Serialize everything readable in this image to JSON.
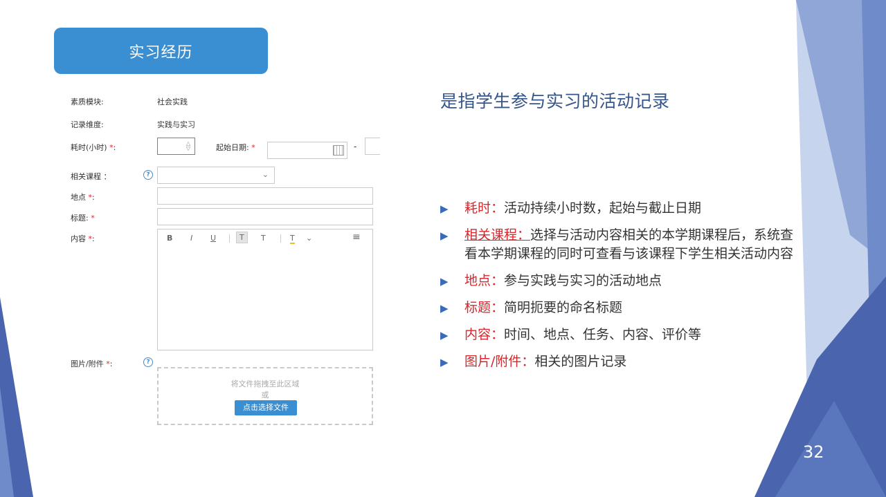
{
  "header": {
    "title": "实习经历"
  },
  "form": {
    "module_label": "素质模块:",
    "module_value": "社会实践",
    "dimension_label": "记录维度:",
    "dimension_value": "实践与实习",
    "hours_label": "耗时(小时)",
    "start_date_label": "起始日期:",
    "date_separator": "-",
    "course_label": "相关课程 ：",
    "location_label": "地点",
    "title_label": "标题:",
    "content_label": "内容",
    "attachment_label": "图片/附件",
    "required_mark": "*",
    "colon": ":",
    "editor_toolbar": {
      "bold": "B",
      "italic": "I",
      "underline": "U",
      "font_size": "T",
      "text_style": "T",
      "font_color": "T"
    },
    "upload": {
      "hint": "将文件拖拽至此区域",
      "or": "或",
      "button": "点击选择文件"
    }
  },
  "heading": "是指学生参与实习的活动记录",
  "bullets": [
    {
      "term": "耗时",
      "sep": "：",
      "text": "活动持续小时数，起始与截止日期"
    },
    {
      "term": "相关课程：",
      "sep": "",
      "text": "选择与活动内容相关的本学期课程后，系统查看本学期课程的同时可查看与该课程下学生相关活动内容"
    },
    {
      "term": "地点",
      "sep": "：",
      "text": "参与实践与实习的活动地点"
    },
    {
      "term": "标题",
      "sep": "：",
      "text": "简明扼要的命名标题"
    },
    {
      "term": "内容",
      "sep": "：",
      "text": "时间、地点、任务、内容、评价等"
    },
    {
      "term": "图片/附件",
      "sep": "：",
      "text": "相关的图片记录"
    }
  ],
  "page_number": "32",
  "colors": {
    "accent": "#3a8fd3",
    "heading": "#34558b",
    "term": "#d9262b",
    "deco_dark": "#4b64ae",
    "deco_light": "#a9bde3"
  }
}
